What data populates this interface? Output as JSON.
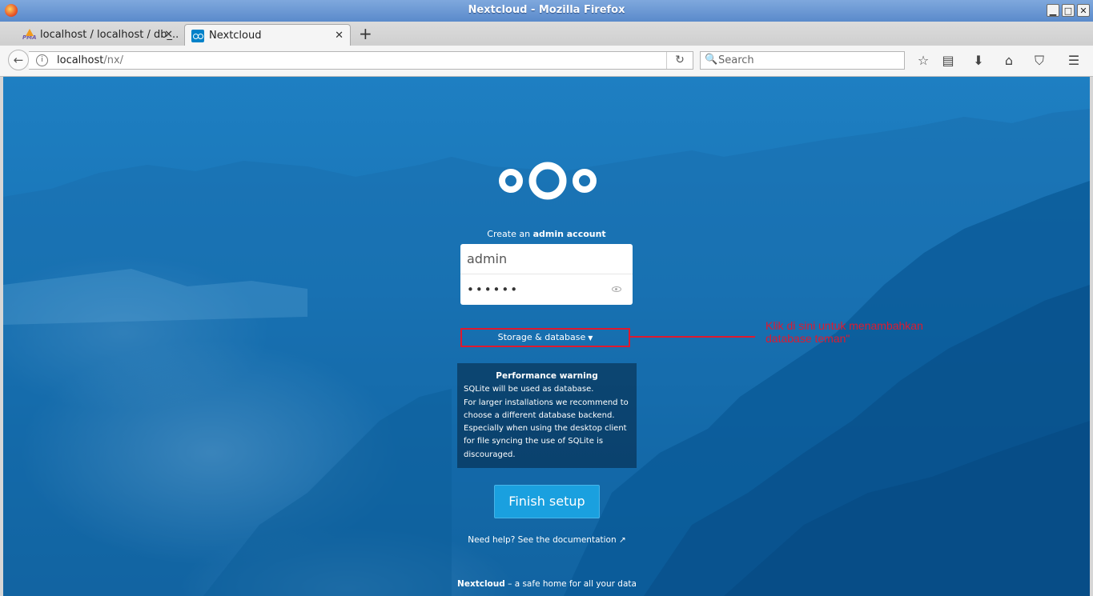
{
  "window": {
    "title": "Nextcloud - Mozilla Firefox",
    "minimize": "▁",
    "maximize": "□",
    "close": "✕"
  },
  "tabs": [
    {
      "label": "localhost / localhost / db_...",
      "icon": "phpmyadmin-icon",
      "icon_text": "PMA"
    },
    {
      "label": "Nextcloud",
      "icon": "nextcloud-icon"
    }
  ],
  "tab_close": "✕",
  "new_tab": "+",
  "navbar": {
    "url_host": "localhost",
    "url_path": "/nx/",
    "search_placeholder": "Search",
    "back": "←",
    "reload": "↻",
    "info": "i",
    "icons": [
      "bookmark-star-icon",
      "reading-list-icon",
      "downloads-icon",
      "home-icon",
      "pocket-icon",
      "menu-icon"
    ],
    "glyphs": {
      "star": "☆",
      "list": "▤",
      "download": "⬇",
      "home": "⌂",
      "pocket": "⛉",
      "menu": "☰",
      "search": "🔍"
    }
  },
  "page": {
    "create_prefix": "Create an ",
    "create_bold": "admin account",
    "username_value": "admin",
    "password_value": "••••••",
    "storage_label": "Storage & database",
    "storage_caret": "▼",
    "annotation": "Klik di sini untuk menambahkan database teman\"",
    "warning_title": "Performance warning",
    "warning_lines": [
      "SQLite will be used as database.",
      "For larger installations we recommend to",
      "choose a different database backend.",
      "Especially when using the desktop client",
      "for file syncing the use of SQLite is",
      "discouraged."
    ],
    "finish_label": "Finish setup",
    "help_text": "Need help? See the documentation ↗",
    "footer_brand": "Nextcloud",
    "footer_rest": " – a safe home for all your data"
  },
  "colors": {
    "brand": "#0082c9",
    "button": "#1aa0df",
    "annotation": "#e0192e"
  }
}
